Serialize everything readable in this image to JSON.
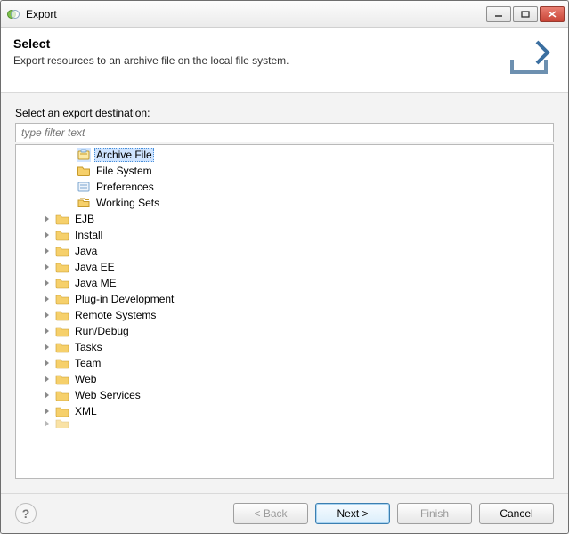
{
  "window": {
    "title": "Export"
  },
  "header": {
    "title": "Select",
    "subtitle": "Export resources to an archive file on the local file system."
  },
  "body": {
    "destination_label": "Select an export destination:",
    "filter_placeholder": "type filter text"
  },
  "tree": {
    "general_children": [
      {
        "label": "Archive File",
        "icon": "archive-file-icon",
        "selected": true
      },
      {
        "label": "File System",
        "icon": "folder-small-icon",
        "selected": false
      },
      {
        "label": "Preferences",
        "icon": "preferences-icon",
        "selected": false
      },
      {
        "label": "Working Sets",
        "icon": "working-sets-icon",
        "selected": false
      }
    ],
    "categories": [
      {
        "label": "EJB"
      },
      {
        "label": "Install"
      },
      {
        "label": "Java"
      },
      {
        "label": "Java EE"
      },
      {
        "label": "Java ME"
      },
      {
        "label": "Plug-in Development"
      },
      {
        "label": "Remote Systems"
      },
      {
        "label": "Run/Debug"
      },
      {
        "label": "Tasks"
      },
      {
        "label": "Team"
      },
      {
        "label": "Web"
      },
      {
        "label": "Web Services"
      },
      {
        "label": "XML"
      }
    ]
  },
  "buttons": {
    "back": "< Back",
    "next": "Next >",
    "finish": "Finish",
    "cancel": "Cancel"
  }
}
